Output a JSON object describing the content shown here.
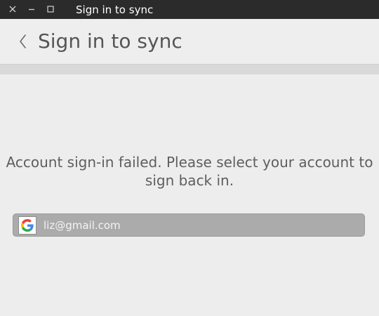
{
  "window": {
    "title": "Sign in to sync",
    "controls": [
      "close-icon",
      "minimize-icon",
      "maximize-icon"
    ]
  },
  "header": {
    "back_icon": "chevron-left-icon",
    "title": "Sign in to sync"
  },
  "main": {
    "message": "Account sign-in failed. Please select your account to sign back in.",
    "account": {
      "provider_icon": "google-icon",
      "email": "liz@gmail.com"
    }
  },
  "colors": {
    "titlebar": "#2b2b2b",
    "background": "#ededed",
    "account_row": "#ababab",
    "text": "#5e5e5e"
  }
}
